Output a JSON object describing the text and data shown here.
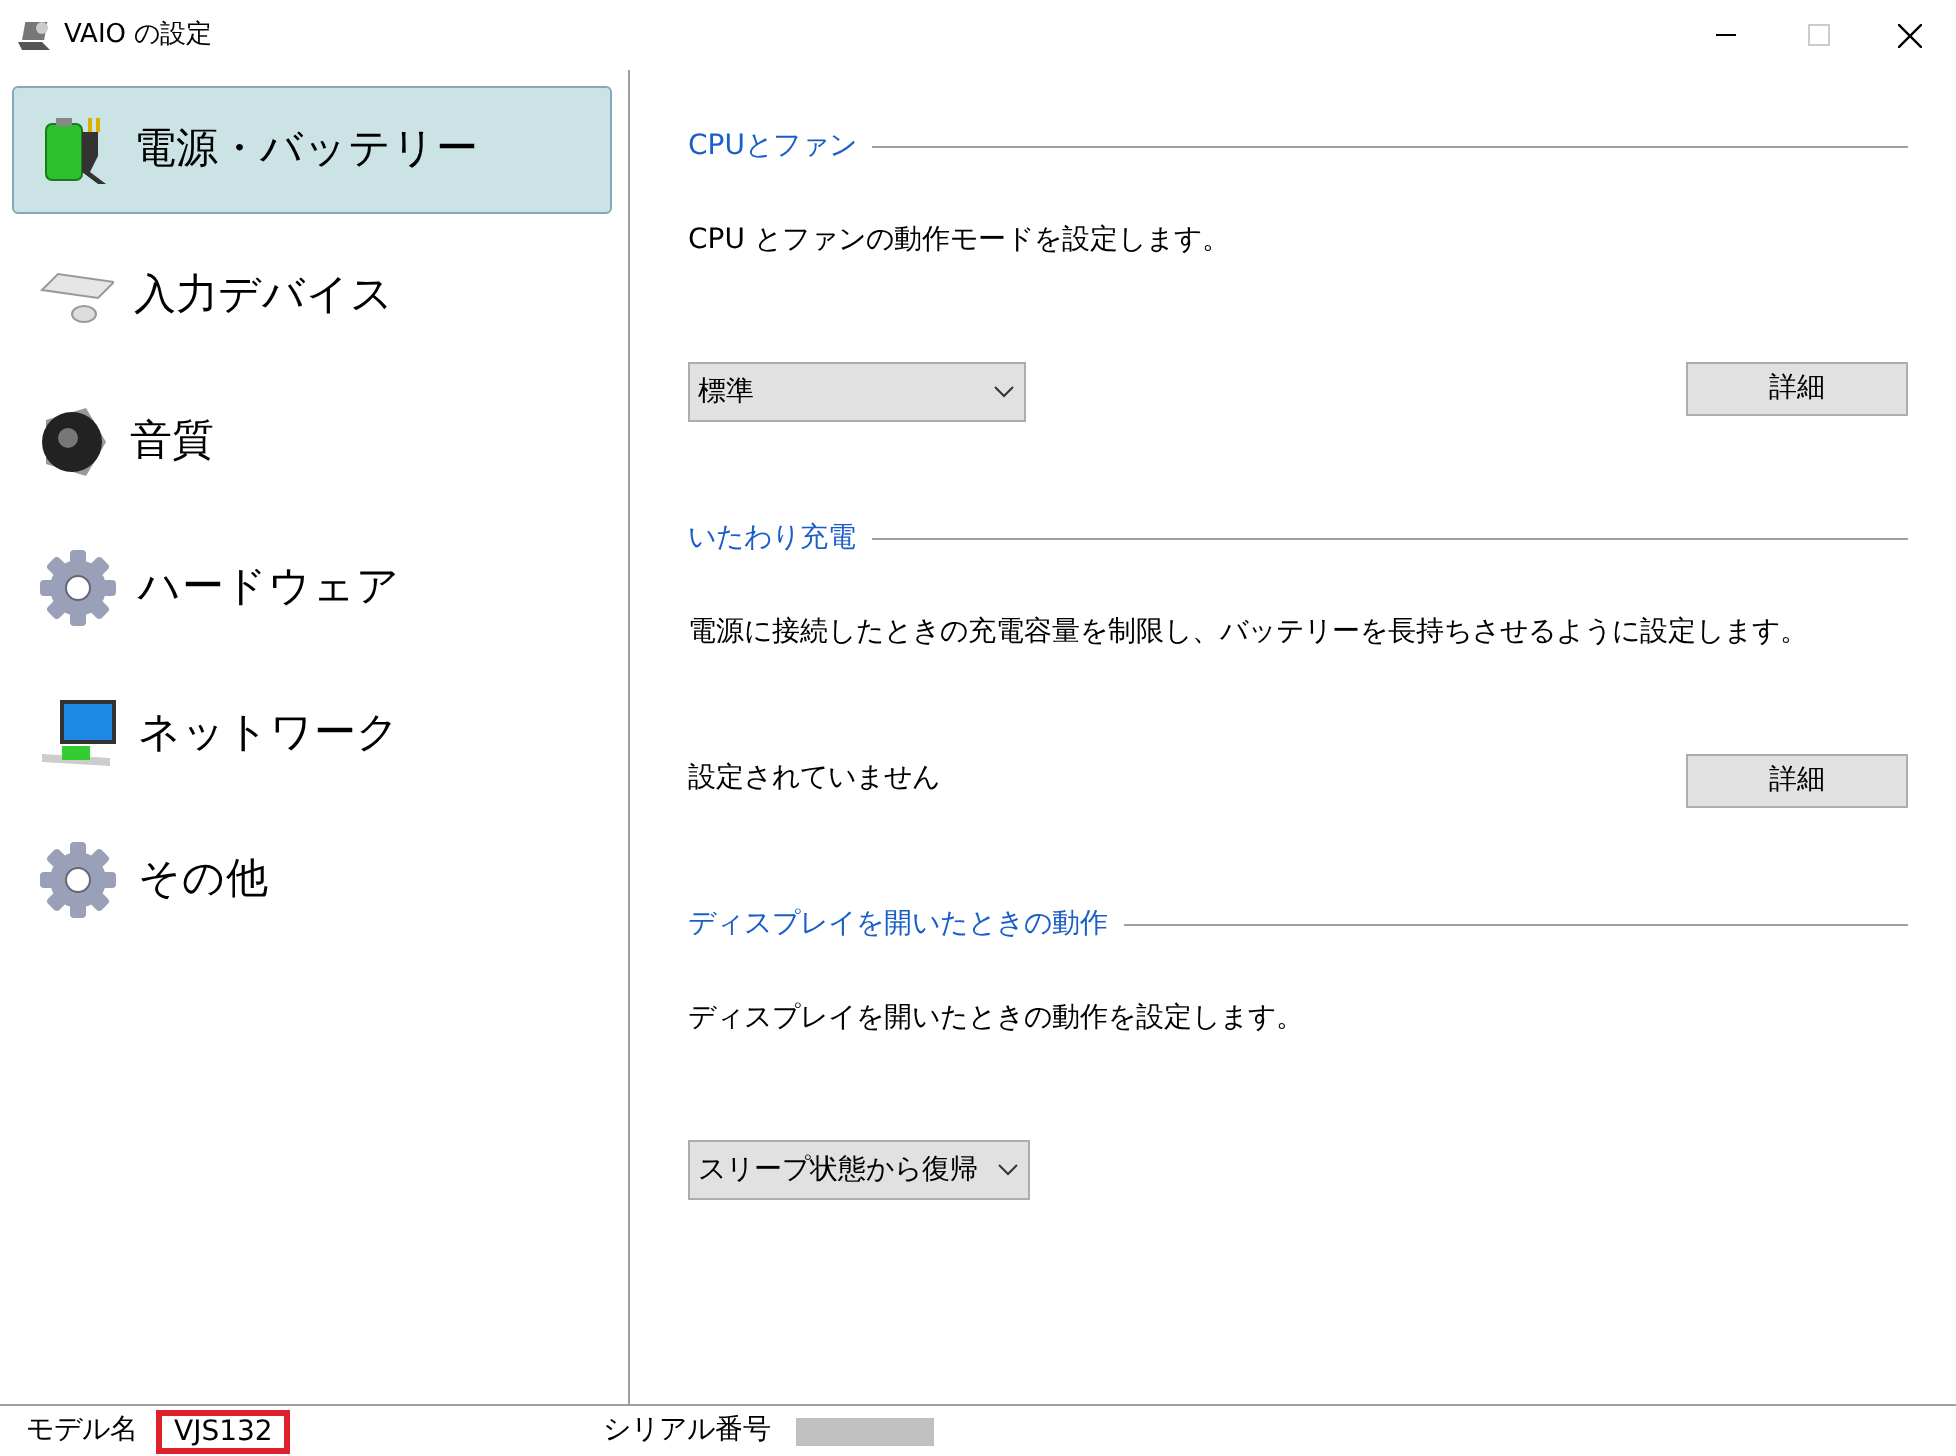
{
  "window": {
    "title": "VAIO の設定"
  },
  "sidebar": {
    "items": [
      {
        "label": "電源・バッテリー",
        "kind": "battery",
        "selected": true
      },
      {
        "label": "入力デバイス",
        "kind": "keyboard",
        "selected": false
      },
      {
        "label": "音質",
        "kind": "speaker",
        "selected": false
      },
      {
        "label": "ハードウェア",
        "kind": "gear",
        "selected": false
      },
      {
        "label": "ネットワーク",
        "kind": "network",
        "selected": false
      },
      {
        "label": "その他",
        "kind": "gear",
        "selected": false
      }
    ]
  },
  "sections": [
    {
      "heading": "CPUとファン",
      "description": "CPU とファンの動作モードを設定します。",
      "select": "標準",
      "button": "詳細"
    },
    {
      "heading": "いたわり充電",
      "description": "電源に接続したときの充電容量を制限し、バッテリーを長持ちさせるように設定します。",
      "status": "設定されていません",
      "button": "詳細"
    },
    {
      "heading": "ディスプレイを開いたときの動作",
      "description": "ディスプレイを開いたときの動作を設定します。",
      "select": "スリープ状態から復帰"
    }
  ],
  "status_bar": {
    "model_label": "モデル名",
    "model_value": "VJS132",
    "serial_label": "シリアル番号"
  }
}
